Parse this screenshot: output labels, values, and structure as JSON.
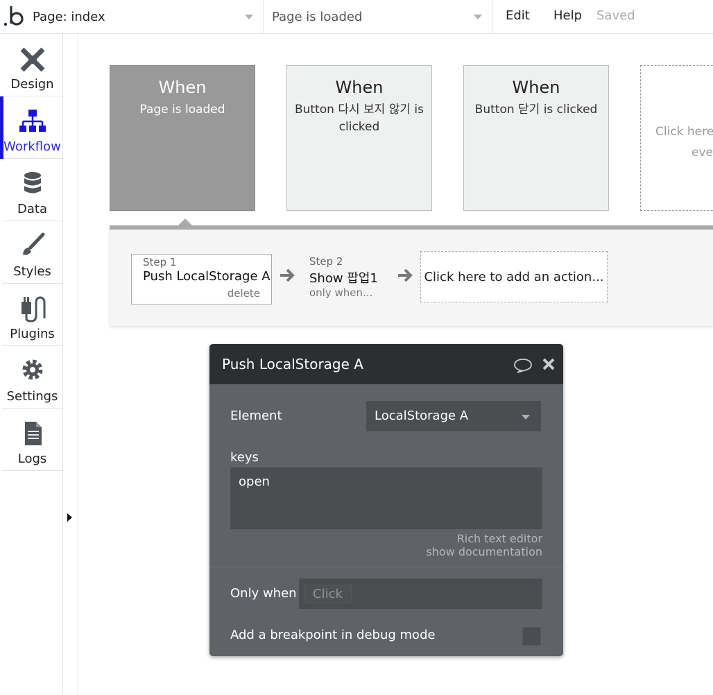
{
  "topbar": {
    "page_selector": "Page: index",
    "event_selector": "Page is loaded",
    "menu": {
      "edit": "Edit",
      "help": "Help",
      "status": "Saved"
    }
  },
  "sidebar": {
    "items": [
      {
        "label": "Design",
        "icon": "design-icon"
      },
      {
        "label": "Workflow",
        "icon": "workflow-icon",
        "active": true
      },
      {
        "label": "Data",
        "icon": "database-icon"
      },
      {
        "label": "Styles",
        "icon": "brush-icon"
      },
      {
        "label": "Plugins",
        "icon": "plugin-icon"
      },
      {
        "label": "Settings",
        "icon": "gear-icon"
      },
      {
        "label": "Logs",
        "icon": "document-icon"
      }
    ]
  },
  "events": [
    {
      "when": "When",
      "desc": "Page is loaded",
      "active": true
    },
    {
      "when": "When",
      "desc": "Button 다시 보지 않기 is clicked"
    },
    {
      "when": "When",
      "desc": "Button 닫기 is clicked"
    },
    {
      "desc_line1": "Click here",
      "desc_line2": "eve"
    }
  ],
  "workflow": {
    "steps": [
      {
        "num": "Step 1",
        "name": "Push LocalStorage A",
        "sub": "delete"
      },
      {
        "num": "Step 2",
        "name": "Show 팝업1",
        "sub": "only when..."
      }
    ],
    "add_action": "Click here to add an action..."
  },
  "panel": {
    "title": "Push LocalStorage A",
    "element_label": "Element",
    "element_value": "LocalStorage A",
    "keys_label": "keys",
    "keys_value": "open",
    "rich_text_link": "Rich text editor",
    "doc_link": "show documentation",
    "only_when_label": "Only when",
    "only_when_placeholder": "Click",
    "breakpoint_label": "Add a breakpoint in debug mode"
  },
  "colors": {
    "active_accent": "#1a12e0",
    "panel_bg": "#5f6367",
    "panel_header": "#2b2f32",
    "active_event": "#999999"
  }
}
